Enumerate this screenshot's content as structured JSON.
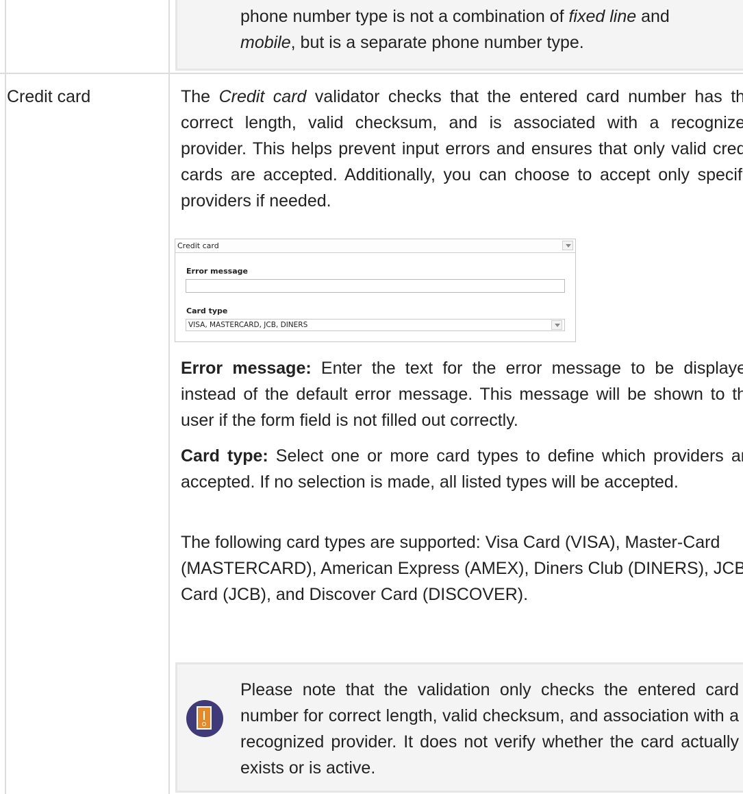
{
  "top_note": {
    "line1_before": "phone number type is not a combination of ",
    "line1_em": "fixed line",
    "line1_after": " and",
    "line2_em": "mobile",
    "line2_after": ", but is a separate phone number type."
  },
  "row": {
    "label": "Credit card",
    "intro_before": "The ",
    "intro_em": "Credit card",
    "intro_after": " validator checks that the entered card number has the correct length, valid checksum, and is associated with a recognized provider. This helps prevent input errors and ensures that only valid credit cards are accepted. Additionally, you can choose to accept only specific providers if needed."
  },
  "screenshot": {
    "header": "Credit card",
    "error_label": "Error message",
    "error_value": "",
    "card_type_label": "Card type",
    "card_type_value": "VISA, MASTERCARD, JCB, DINERS"
  },
  "error_message": {
    "term": "Error message:",
    "text": " Enter the text for the error message to be displayed instead of the default error message. This message will be shown to the user if the form field is not filled out correctly."
  },
  "card_type": {
    "term": "Card type:",
    "text": " Select one or more card types to define which providers are accepted. If no selection is made, all listed types will be accepted."
  },
  "supported": "The following card types are supported: Visa Card (VISA), Master-Card (MASTERCARD), American Express (AMEX), Diners Club (DINERS), JCB Card (JCB), and Discover Card (DISCOVER).",
  "note": "Please note that the validation only checks the entered card number for correct length, valid checksum, and association with a recognized provider. It does not verify whether the card actually exists or is active.",
  "colors": {
    "icon_bg": "#3f3a78",
    "icon_fg": "#e58a2b",
    "note_bg": "#f4f4f4",
    "grid": "#dcdcdc"
  }
}
